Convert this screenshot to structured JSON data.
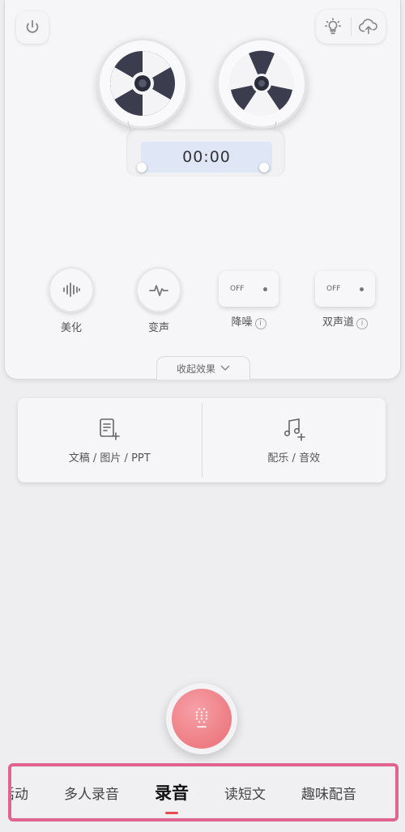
{
  "recorder": {
    "timer": "00:00"
  },
  "effects": [
    {
      "label": "美化",
      "kind": "icon",
      "icon": "waveform-icon"
    },
    {
      "label": "变声",
      "kind": "icon",
      "icon": "pulse-icon"
    },
    {
      "label": "降噪",
      "kind": "toggle",
      "state": "OFF",
      "info": "i"
    },
    {
      "label": "双声道",
      "kind": "toggle",
      "state": "OFF",
      "info": "i"
    }
  ],
  "collapse_label": "收起效果",
  "tools": [
    {
      "label": "文稿 / 图片 / PPT",
      "icon": "document-add-icon"
    },
    {
      "label": "配乐 / 音效",
      "icon": "music-note-add-icon"
    }
  ],
  "nav": {
    "items": [
      "作活动",
      "多人录音",
      "录音",
      "读短文",
      "趣味配音"
    ],
    "active": "录音"
  },
  "colors": {
    "record_button": "#ea6d75",
    "nav_highlight_border": "#e0648f",
    "active_indicator": "#e84a4f",
    "timer_background": "#dfe6f5"
  }
}
